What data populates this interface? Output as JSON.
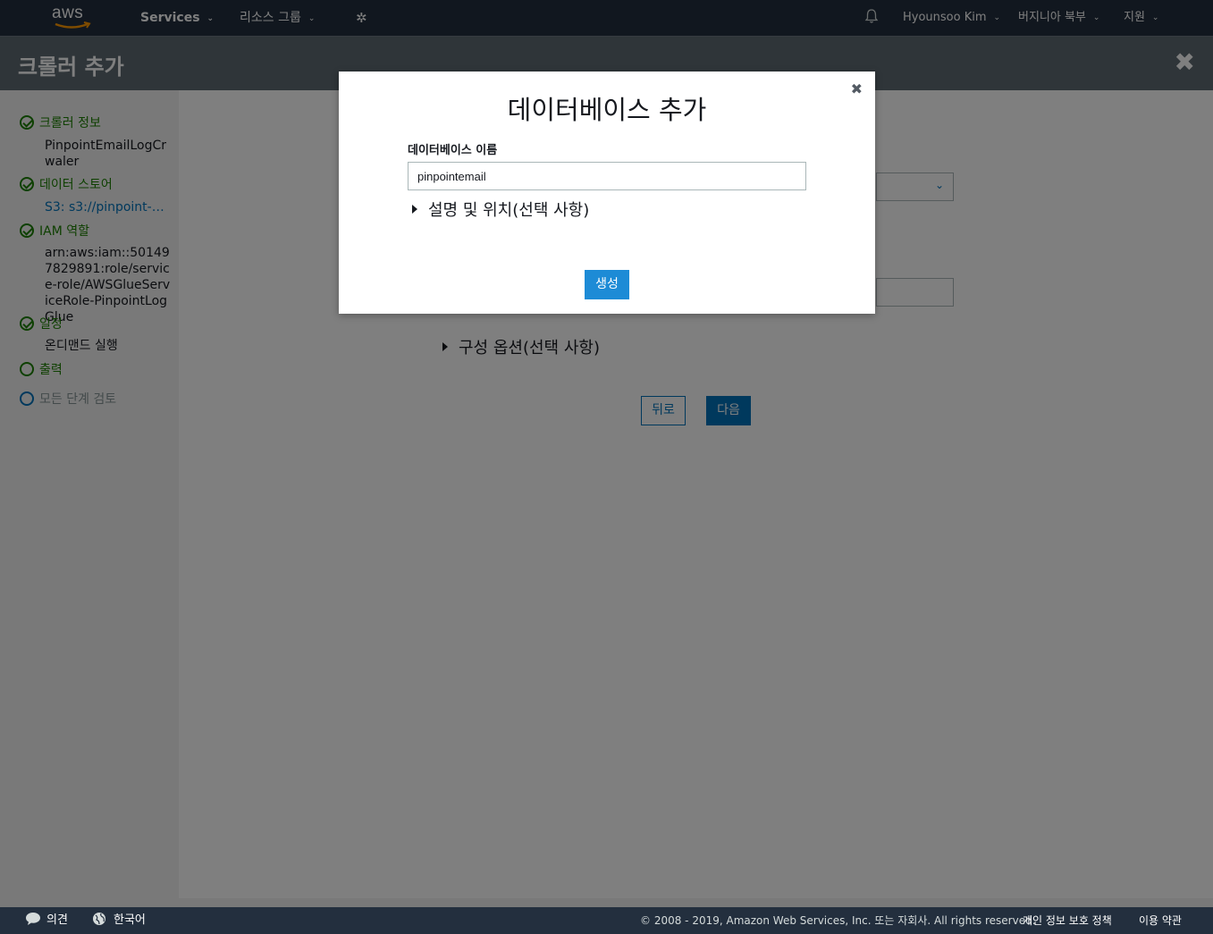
{
  "nav": {
    "logo_text": "aws",
    "services": "Services",
    "resource_groups": "리소스 그룹",
    "user": "Hyounsoo Kim",
    "region": "버지니아 북부",
    "support": "지원"
  },
  "header": {
    "title": "크롤러 추가"
  },
  "sidebar": {
    "steps": [
      {
        "label": "크롤러 정보",
        "detail": "PinpointEmailLogCrwaler",
        "state": "done"
      },
      {
        "label": "데이터 스토어",
        "detail": "S3: s3://pinpoint-data...",
        "state": "done"
      },
      {
        "label": "IAM 역할",
        "detail": "arn:aws:iam::501497829891:role/service-role/AWSGlueServiceRole-PinpointLogGlue",
        "state": "done"
      },
      {
        "label": "일정",
        "detail": "온디맨드 실행",
        "state": "done"
      },
      {
        "label": "출력",
        "detail": "",
        "state": "current"
      },
      {
        "label": "모든 단계 검토",
        "detail": "",
        "state": "pending"
      }
    ]
  },
  "main": {
    "config_options": "구성 옵션(선택 사항)",
    "back": "뒤로",
    "next": "다음"
  },
  "modal": {
    "title": "데이터베이스 추가",
    "field_label": "데이터베이스 이름",
    "field_value": "pinpointemail",
    "expander": "설명 및 위치(선택 사항)",
    "create": "생성"
  },
  "footer": {
    "feedback": "의견",
    "language": "한국어",
    "copyright": "© 2008 - 2019, Amazon Web Services, Inc. 또는 자회사. All rights reserved.",
    "privacy": "개인 정보 보호 정책",
    "terms": "이용 약관"
  },
  "colors": {
    "nav_bg": "#232f3e",
    "accent_blue": "#0073bb",
    "success_green": "#1d8102"
  }
}
